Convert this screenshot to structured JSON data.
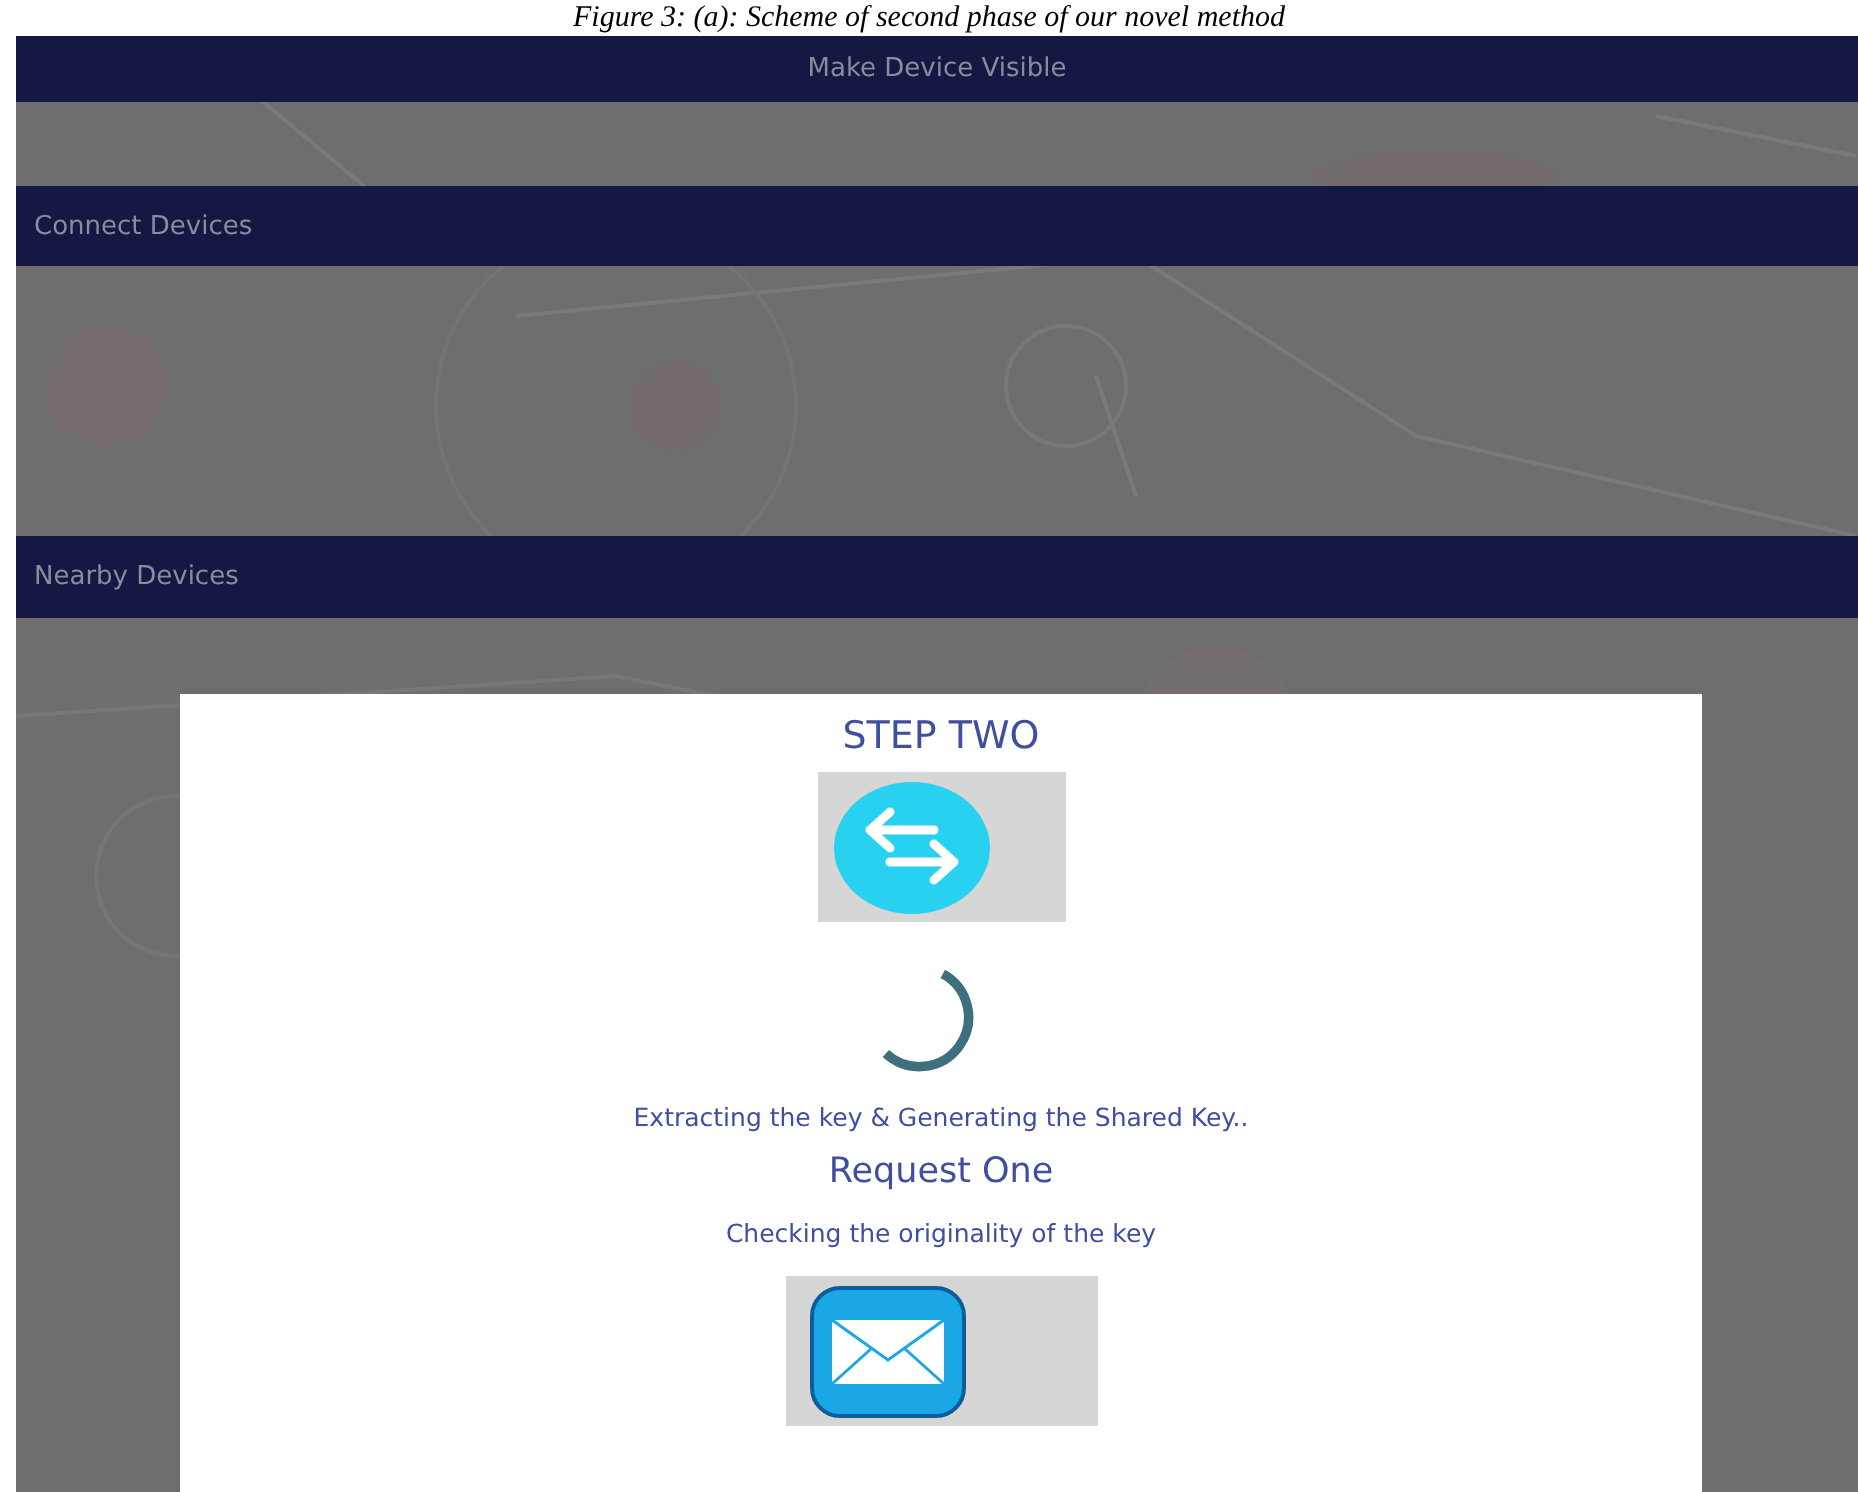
{
  "caption": "Figure 3: (a): Scheme of second phase of our novel method",
  "sections": [
    {
      "title": "Make Device Visible",
      "kind": "title"
    },
    {
      "title": "Connect Devices",
      "kind": "section"
    },
    {
      "title": "Nearby Devices",
      "kind": "section"
    }
  ],
  "dialog": {
    "title": "STEP TWO",
    "status": "Extracting the key & Generating the Shared Key..",
    "request_title": "Request One",
    "request_status": "Checking the originality of the key"
  }
}
